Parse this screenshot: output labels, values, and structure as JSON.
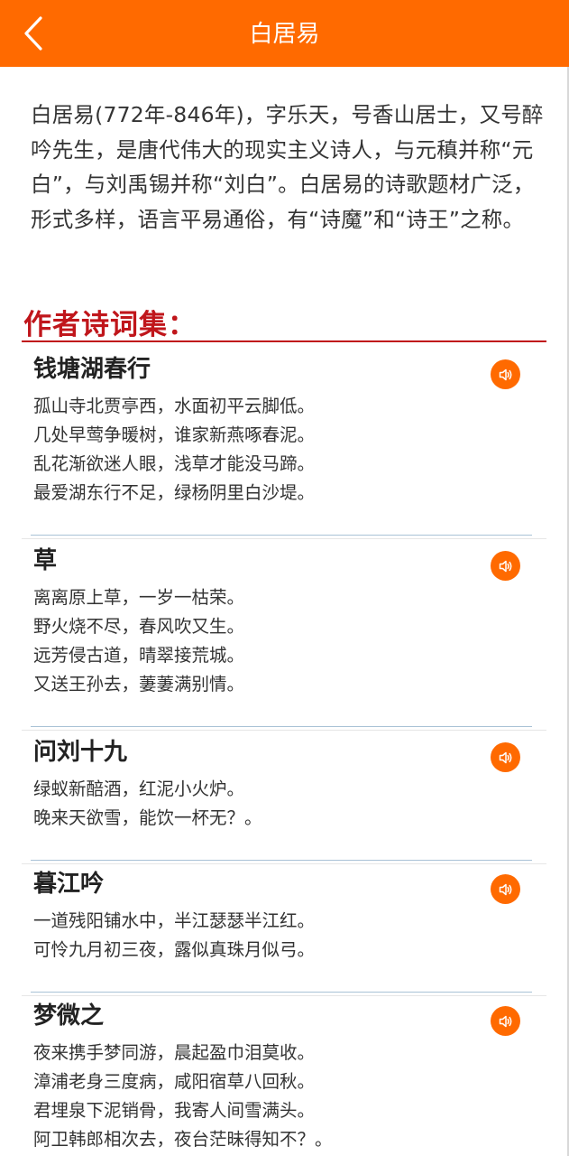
{
  "header": {
    "title": "白居易",
    "back_icon": "chevron-left-icon",
    "background_color": "#ff6a00"
  },
  "intro": "白居易(772年-846年)，字乐天，号香山居士，又号醉吟先生，是唐代伟大的现实主义诗人，与元稹并称“元白”，与刘禹锡并称“刘白”。白居易的诗歌题材广泛，形式多样，语言平易通俗，有“诗魔”和“诗王”之称。",
  "section": {
    "title": "作者诗词集：",
    "color": "#c0161b"
  },
  "audio_icon": "speaker-icon",
  "poems": [
    {
      "title": "钱塘湖春行",
      "lines": [
        "孤山寺北贾亭西，水面初平云脚低。",
        "几处早莺争暖树，谁家新燕啄春泥。",
        "乱花渐欲迷人眼，浅草才能没马蹄。",
        "最爱湖东行不足，绿杨阴里白沙堤。"
      ]
    },
    {
      "title": "草",
      "lines": [
        "离离原上草，一岁一枯荣。",
        "野火烧不尽，春风吹又生。",
        "远芳侵古道，晴翠接荒城。",
        "又送王孙去，萋萋满别情。"
      ]
    },
    {
      "title": "问刘十九",
      "lines": [
        "绿蚁新醅酒，红泥小火炉。",
        "晚来天欲雪，能饮一杯无？。"
      ]
    },
    {
      "title": "暮江吟",
      "lines": [
        "一道残阳铺水中，半江瑟瑟半江红。",
        "可怜九月初三夜，露似真珠月似弓。"
      ]
    },
    {
      "title": "梦微之",
      "lines": [
        "夜来携手梦同游，晨起盈巾泪莫收。",
        "漳浦老身三度病，咸阳宿草八回秋。",
        "君埋泉下泥销骨，我寄人间雪满头。",
        "阿卫韩郎相次去，夜台茫昧得知不？。"
      ]
    }
  ]
}
